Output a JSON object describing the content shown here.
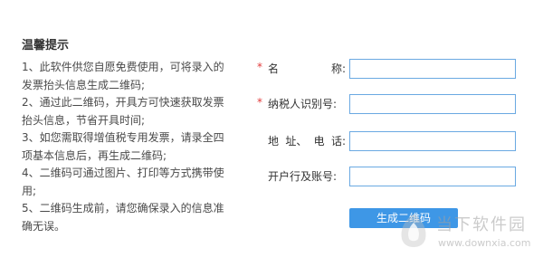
{
  "tips": {
    "title": "温馨提示",
    "items": [
      "1、此软件供您自愿免费使用，可将录入的发票抬头信息生成二维码;",
      "2、通过此二维码，开具方可快速获取发票抬头信息，节省开具时间;",
      "3、如您需取得增值税专用发票，请录全四项基本信息后，再生成二维码;",
      "4、二维码可通过图片、打印等方式携带使用;",
      "5、二维码生成前，请您确保录入的信息准确无误。"
    ]
  },
  "form": {
    "required_mark": "*",
    "name_label_a": "名",
    "name_label_b": "称:",
    "taxid_label": "纳税人识别号:",
    "address_label_a": "地",
    "address_label_b": "址、",
    "address_label_c": "电",
    "address_label_d": "话:",
    "bank_label": "开户行及账号:",
    "name_value": "",
    "taxid_value": "",
    "address_value": "",
    "bank_value": "",
    "generate_button": "生成二维码"
  },
  "watermark": {
    "title": "当下软件园",
    "url": "www.downxia.com"
  },
  "colors": {
    "accent": "#3e97e6",
    "input_border": "#6aa9e2",
    "required": "#e23b3b"
  }
}
